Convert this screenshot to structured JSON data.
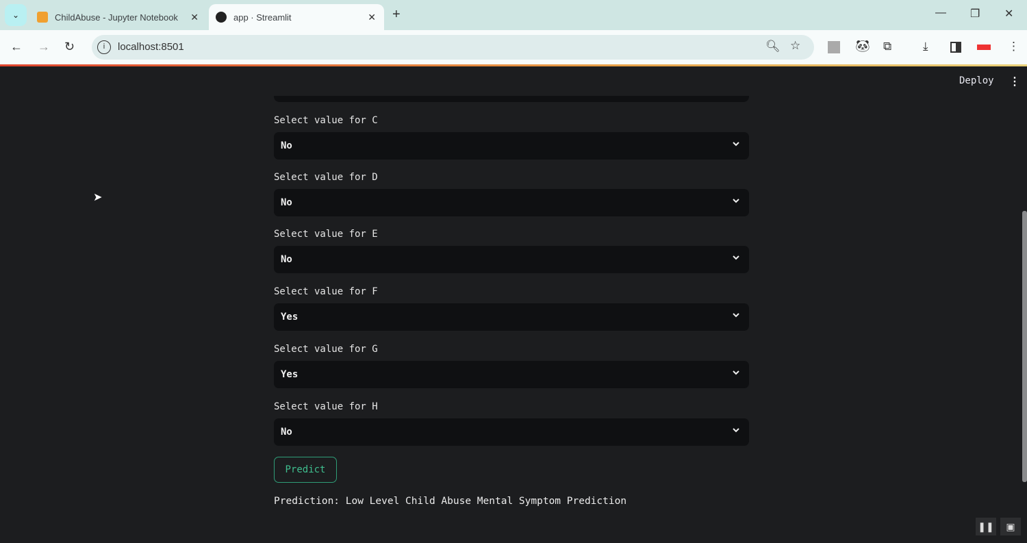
{
  "browser": {
    "tabs": [
      {
        "title": "ChildAbuse - Jupyter Notebook",
        "icon": "notebook-icon",
        "active": false
      },
      {
        "title": "app · Streamlit",
        "icon": "streamlit-crown-icon",
        "active": true
      }
    ],
    "url": "localhost:8501"
  },
  "app": {
    "deploy_label": "Deploy",
    "fields": [
      {
        "label": "Select value for C",
        "value": "No"
      },
      {
        "label": "Select value for D",
        "value": "No"
      },
      {
        "label": "Select value for E",
        "value": "No"
      },
      {
        "label": "Select value for F",
        "value": "Yes"
      },
      {
        "label": "Select value for G",
        "value": "Yes"
      },
      {
        "label": "Select value for H",
        "value": "No"
      }
    ],
    "predict_label": "Predict",
    "prediction_text": "Prediction: Low Level Child Abuse Mental Symptom Prediction",
    "accent_color": "#2f9e78"
  }
}
